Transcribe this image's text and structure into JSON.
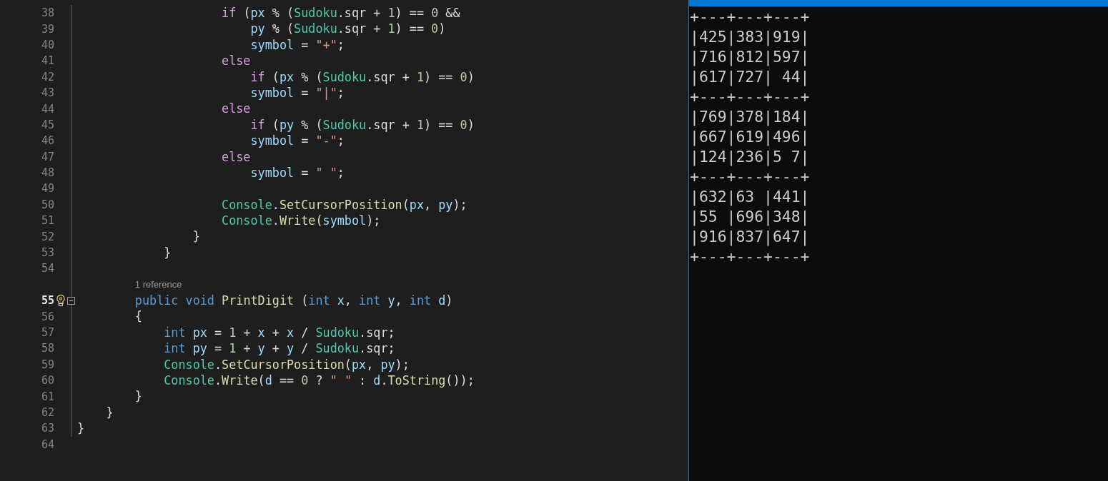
{
  "editor": {
    "lines": [
      {
        "kind": "code",
        "number": "38",
        "tokens": [
          {
            "text": "                    if",
            "kind": "control"
          },
          {
            "text": " (",
            "kind": "plain"
          },
          {
            "text": "px",
            "kind": "var"
          },
          {
            "text": " % (",
            "kind": "plain"
          },
          {
            "text": "Sudoku",
            "kind": "type"
          },
          {
            "text": ".sqr + ",
            "kind": "plain"
          },
          {
            "text": "1",
            "kind": "number"
          },
          {
            "text": ") == ",
            "kind": "plain"
          },
          {
            "text": "0",
            "kind": "number"
          },
          {
            "text": " &&",
            "kind": "plain"
          }
        ]
      },
      {
        "kind": "code",
        "number": "39",
        "tokens": [
          {
            "text": "                        py",
            "kind": "var"
          },
          {
            "text": " % (",
            "kind": "plain"
          },
          {
            "text": "Sudoku",
            "kind": "type"
          },
          {
            "text": ".sqr + ",
            "kind": "plain"
          },
          {
            "text": "1",
            "kind": "number"
          },
          {
            "text": ") == ",
            "kind": "plain"
          },
          {
            "text": "0",
            "kind": "number"
          },
          {
            "text": ")",
            "kind": "plain"
          }
        ]
      },
      {
        "kind": "code",
        "number": "40",
        "tokens": [
          {
            "text": "                        symbol",
            "kind": "var"
          },
          {
            "text": " = ",
            "kind": "plain"
          },
          {
            "text": "\"+\"",
            "kind": "string"
          },
          {
            "text": ";",
            "kind": "plain"
          }
        ]
      },
      {
        "kind": "code",
        "number": "41",
        "tokens": [
          {
            "text": "                    else",
            "kind": "control"
          }
        ]
      },
      {
        "kind": "code",
        "number": "42",
        "tokens": [
          {
            "text": "                        if",
            "kind": "control"
          },
          {
            "text": " (",
            "kind": "plain"
          },
          {
            "text": "px",
            "kind": "var"
          },
          {
            "text": " % (",
            "kind": "plain"
          },
          {
            "text": "Sudoku",
            "kind": "type"
          },
          {
            "text": ".sqr + ",
            "kind": "plain"
          },
          {
            "text": "1",
            "kind": "number"
          },
          {
            "text": ") == ",
            "kind": "plain"
          },
          {
            "text": "0",
            "kind": "number"
          },
          {
            "text": ")",
            "kind": "plain"
          }
        ]
      },
      {
        "kind": "code",
        "number": "43",
        "tokens": [
          {
            "text": "                        symbol",
            "kind": "var"
          },
          {
            "text": " = ",
            "kind": "plain"
          },
          {
            "text": "\"|\"",
            "kind": "string"
          },
          {
            "text": ";",
            "kind": "plain"
          }
        ]
      },
      {
        "kind": "code",
        "number": "44",
        "tokens": [
          {
            "text": "                    else",
            "kind": "control"
          }
        ]
      },
      {
        "kind": "code",
        "number": "45",
        "tokens": [
          {
            "text": "                        if",
            "kind": "control"
          },
          {
            "text": " (",
            "kind": "plain"
          },
          {
            "text": "py",
            "kind": "var"
          },
          {
            "text": " % (",
            "kind": "plain"
          },
          {
            "text": "Sudoku",
            "kind": "type"
          },
          {
            "text": ".sqr + ",
            "kind": "plain"
          },
          {
            "text": "1",
            "kind": "number"
          },
          {
            "text": ") == ",
            "kind": "plain"
          },
          {
            "text": "0",
            "kind": "number"
          },
          {
            "text": ")",
            "kind": "plain"
          }
        ]
      },
      {
        "kind": "code",
        "number": "46",
        "tokens": [
          {
            "text": "                        symbol",
            "kind": "var"
          },
          {
            "text": " = ",
            "kind": "plain"
          },
          {
            "text": "\"-\"",
            "kind": "string"
          },
          {
            "text": ";",
            "kind": "plain"
          }
        ]
      },
      {
        "kind": "code",
        "number": "47",
        "tokens": [
          {
            "text": "                    else",
            "kind": "control"
          }
        ]
      },
      {
        "kind": "code",
        "number": "48",
        "tokens": [
          {
            "text": "                        symbol",
            "kind": "var"
          },
          {
            "text": " = ",
            "kind": "plain"
          },
          {
            "text": "\" \"",
            "kind": "string"
          },
          {
            "text": ";",
            "kind": "plain"
          }
        ]
      },
      {
        "kind": "code",
        "number": "49"
      },
      {
        "kind": "code",
        "number": "50",
        "tokens": [
          {
            "text": "                    Console",
            "kind": "type"
          },
          {
            "text": ".",
            "kind": "plain"
          },
          {
            "text": "SetCursorPosition",
            "kind": "method"
          },
          {
            "text": "(",
            "kind": "plain"
          },
          {
            "text": "px",
            "kind": "var"
          },
          {
            "text": ", ",
            "kind": "plain"
          },
          {
            "text": "py",
            "kind": "var"
          },
          {
            "text": ");",
            "kind": "plain"
          }
        ]
      },
      {
        "kind": "code",
        "number": "51",
        "tokens": [
          {
            "text": "                    Console",
            "kind": "type"
          },
          {
            "text": ".",
            "kind": "plain"
          },
          {
            "text": "Write",
            "kind": "method"
          },
          {
            "text": "(",
            "kind": "plain"
          },
          {
            "text": "symbol",
            "kind": "var"
          },
          {
            "text": ");",
            "kind": "plain"
          }
        ]
      },
      {
        "kind": "code",
        "number": "52",
        "tokens": [
          {
            "text": "                }",
            "kind": "plain"
          }
        ]
      },
      {
        "kind": "code",
        "number": "53",
        "tokens": [
          {
            "text": "            }",
            "kind": "plain"
          }
        ]
      },
      {
        "kind": "code",
        "number": "54"
      },
      {
        "kind": "codelens",
        "text": "1 reference"
      },
      {
        "kind": "code",
        "number": "55",
        "current": true,
        "lightbulb": true,
        "collapsible": true,
        "tokens": [
          {
            "text": "        public void",
            "kind": "keyword"
          },
          {
            "text": " PrintDigit",
            "kind": "method"
          },
          {
            "text": " (",
            "kind": "plain"
          },
          {
            "text": "int",
            "kind": "keyword"
          },
          {
            "text": " x",
            "kind": "var"
          },
          {
            "text": ", ",
            "kind": "plain"
          },
          {
            "text": "int",
            "kind": "keyword"
          },
          {
            "text": " y",
            "kind": "var"
          },
          {
            "text": ", ",
            "kind": "plain"
          },
          {
            "text": "int",
            "kind": "keyword"
          },
          {
            "text": " d",
            "kind": "var"
          },
          {
            "text": ")",
            "kind": "plain"
          }
        ]
      },
      {
        "kind": "code",
        "number": "56",
        "tokens": [
          {
            "text": "        {",
            "kind": "plain"
          }
        ]
      },
      {
        "kind": "code",
        "number": "57",
        "tokens": [
          {
            "text": "            int",
            "kind": "keyword"
          },
          {
            "text": " px",
            "kind": "var"
          },
          {
            "text": " = ",
            "kind": "plain"
          },
          {
            "text": "1",
            "kind": "number"
          },
          {
            "text": " + ",
            "kind": "plain"
          },
          {
            "text": "x",
            "kind": "var"
          },
          {
            "text": " + ",
            "kind": "plain"
          },
          {
            "text": "x",
            "kind": "var"
          },
          {
            "text": " / ",
            "kind": "plain"
          },
          {
            "text": "Sudoku",
            "kind": "type"
          },
          {
            "text": ".sqr;",
            "kind": "plain"
          }
        ]
      },
      {
        "kind": "code",
        "number": "58",
        "tokens": [
          {
            "text": "            int",
            "kind": "keyword"
          },
          {
            "text": " py",
            "kind": "var"
          },
          {
            "text": " = ",
            "kind": "plain"
          },
          {
            "text": "1",
            "kind": "number"
          },
          {
            "text": " + ",
            "kind": "plain"
          },
          {
            "text": "y",
            "kind": "var"
          },
          {
            "text": " + ",
            "kind": "plain"
          },
          {
            "text": "y",
            "kind": "var"
          },
          {
            "text": " / ",
            "kind": "plain"
          },
          {
            "text": "Sudoku",
            "kind": "type"
          },
          {
            "text": ".sqr;",
            "kind": "plain"
          }
        ]
      },
      {
        "kind": "code",
        "number": "59",
        "tokens": [
          {
            "text": "            Console",
            "kind": "type"
          },
          {
            "text": ".",
            "kind": "plain"
          },
          {
            "text": "SetCursorPosition",
            "kind": "method"
          },
          {
            "text": "(",
            "kind": "plain"
          },
          {
            "text": "px",
            "kind": "var"
          },
          {
            "text": ", ",
            "kind": "plain"
          },
          {
            "text": "py",
            "kind": "var"
          },
          {
            "text": ");",
            "kind": "plain"
          }
        ]
      },
      {
        "kind": "code",
        "number": "60",
        "tokens": [
          {
            "text": "            Console",
            "kind": "type"
          },
          {
            "text": ".",
            "kind": "plain"
          },
          {
            "text": "Write",
            "kind": "method"
          },
          {
            "text": "(",
            "kind": "plain"
          },
          {
            "text": "d",
            "kind": "var"
          },
          {
            "text": " == ",
            "kind": "plain"
          },
          {
            "text": "0",
            "kind": "number"
          },
          {
            "text": " ? ",
            "kind": "plain"
          },
          {
            "text": "\" \"",
            "kind": "string"
          },
          {
            "text": " : ",
            "kind": "plain"
          },
          {
            "text": "d",
            "kind": "var"
          },
          {
            "text": ".",
            "kind": "plain"
          },
          {
            "text": "ToString",
            "kind": "method"
          },
          {
            "text": "());",
            "kind": "plain"
          }
        ]
      },
      {
        "kind": "code",
        "number": "61",
        "tokens": [
          {
            "text": "        }",
            "kind": "plain"
          }
        ]
      },
      {
        "kind": "code",
        "number": "62",
        "tokens": [
          {
            "text": "    }",
            "kind": "plain"
          }
        ]
      },
      {
        "kind": "code",
        "number": "63",
        "tokens": [
          {
            "text": "}",
            "kind": "plain"
          }
        ]
      },
      {
        "kind": "code",
        "number": "64"
      }
    ]
  },
  "console": {
    "lines": [
      "+---+---+---+",
      "|425|383|919|",
      "|716|812|597|",
      "|617|727| 44|",
      "+---+---+---+",
      "|769|378|184|",
      "|667|619|496|",
      "|124|236|5 7|",
      "+---+---+---+",
      "|632|63 |441|",
      "|55 |696|348|",
      "|916|837|647|",
      "+---+---+---+"
    ]
  }
}
